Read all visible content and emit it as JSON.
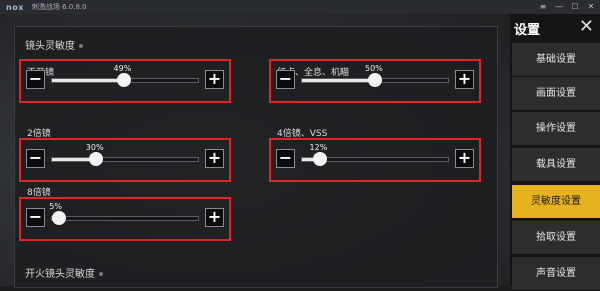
{
  "window": {
    "logo": "nox",
    "title": "刺激战场 6.0.8.0"
  },
  "sections": {
    "scope_sensitivity": "镜头灵敏度",
    "fire_scope_sensitivity": "开火镜头灵敏度"
  },
  "sliders": [
    {
      "label": "不开镜",
      "percent_text": "49%",
      "value": 0.49
    },
    {
      "label": "红点、全息、机瞄",
      "percent_text": "50%",
      "value": 0.5
    },
    {
      "label": "2倍镜",
      "percent_text": "30%",
      "value": 0.3
    },
    {
      "label": "4倍镜、VSS",
      "percent_text": "12%",
      "value": 0.12
    },
    {
      "label": "8倍镜",
      "percent_text": "5%",
      "value": 0.05
    }
  ],
  "sidebar": {
    "title": "设置",
    "items": [
      {
        "label": "基础设置"
      },
      {
        "label": "画面设置"
      },
      {
        "label": "操作设置"
      },
      {
        "label": "载具设置"
      },
      {
        "label": "灵敏度设置",
        "active": true
      },
      {
        "label": "拾取设置"
      },
      {
        "label": "声音设置"
      }
    ]
  },
  "colors": {
    "accent": "#e6b21e",
    "highlight_box": "#e02525"
  }
}
